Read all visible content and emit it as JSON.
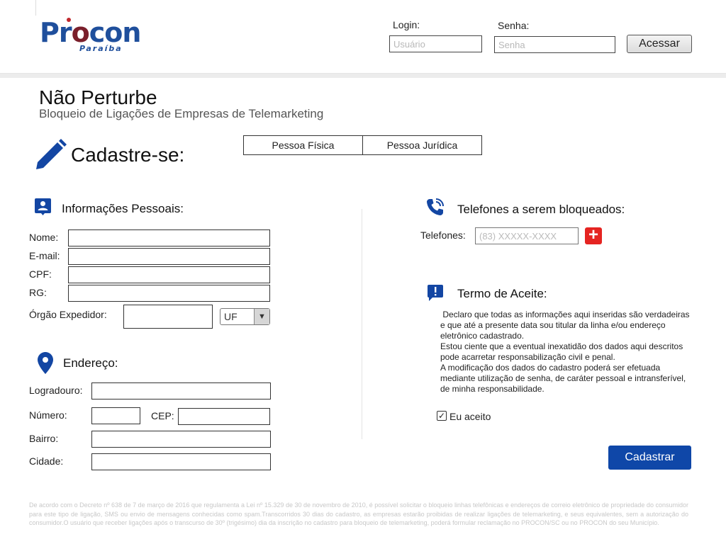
{
  "header": {
    "logo_text_pr": "Pr",
    "logo_text_o": "o",
    "logo_text_con": "con",
    "logo_subtitle": "Paraíba",
    "login_label": "Login:",
    "login_placeholder": "Usuário",
    "password_label": "Senha:",
    "password_placeholder": "Senha",
    "access_button": "Acessar"
  },
  "page": {
    "title": "Não Perturbe",
    "subtitle": "Bloqueio de Ligações de Empresas de Telemarketing",
    "register_title": "Cadastre-se:",
    "tabs": [
      {
        "label": "Pessoa Física"
      },
      {
        "label": "Pessoa Jurídica"
      }
    ]
  },
  "personal": {
    "section_title": "Informações Pessoais:",
    "name_label": "Nome:",
    "email_label": "E-mail:",
    "cpf_label": "CPF:",
    "rg_label": "RG:",
    "issuer_label": "Órgão Expedidor:",
    "uf_value": "UF"
  },
  "address": {
    "section_title": "Endereço:",
    "street_label": "Logradouro:",
    "number_label": "Número:",
    "cep_label": "CEP:",
    "district_label": "Bairro:",
    "city_label": "Cidade:"
  },
  "phones": {
    "section_title": "Telefones a serem bloqueados:",
    "phones_label": "Telefones:",
    "phone_placeholder": "(83) XXXXX-XXXX",
    "add_symbol": "+"
  },
  "terms": {
    "section_title": "Termo de Aceite:",
    "paragraph_1": " Declaro que todas as informações aqui inseridas são verdadeiras e que até a presente data sou titular da linha e/ou endereço eletrônico cadastrado.",
    "paragraph_2": "Estou ciente que a eventual inexatidão dos dados aqui descritos pode acarretar responsabilização civil e penal.",
    "paragraph_3": "A modificação dos dados do cadastro poderá ser efetuada mediante utilização de senha, de caráter pessoal e intransferível, de minha responsabilidade.",
    "accept_label": "Eu aceito",
    "accept_checked": true,
    "check_mark": "✓"
  },
  "submit_button": "Cadastrar",
  "footer_text": "De acordo com o Decreto nº 638 de 7 de março de 2016 que regulamenta a Lei nº 15.329 de 30 de novembro de 2010, é possível solicitar o bloqueio linhas telefônicas e endereços de correio eletrônico de propriedade do consumidor para este tipo de ligação, SMS ou envio de mensagens conhecidas como spam.Transcorridos 30 dias do cadastro, as empresas estarão proibidas de realizar ligações de telemarketing, e seus equivalentes, sem a autorização do consumidor.O usuário que receber ligações após o transcurso de 30º (trigésimo) dia da inscrição no cadastro para bloqueio de telemarketing, poderá formular reclamação no PROCON/SC ou no PROCON do seu Município.",
  "colors": {
    "brand_blue": "#0f47a8",
    "logo_blue": "#1f4f9c",
    "logo_red": "#7a1f2b",
    "add_red": "#e52421"
  },
  "icons": {
    "pencil": "pencil-icon",
    "contact_card": "contact-card-icon",
    "location_pin": "location-pin-icon",
    "phone_call": "phone-call-icon",
    "alert_message": "alert-message-icon"
  }
}
